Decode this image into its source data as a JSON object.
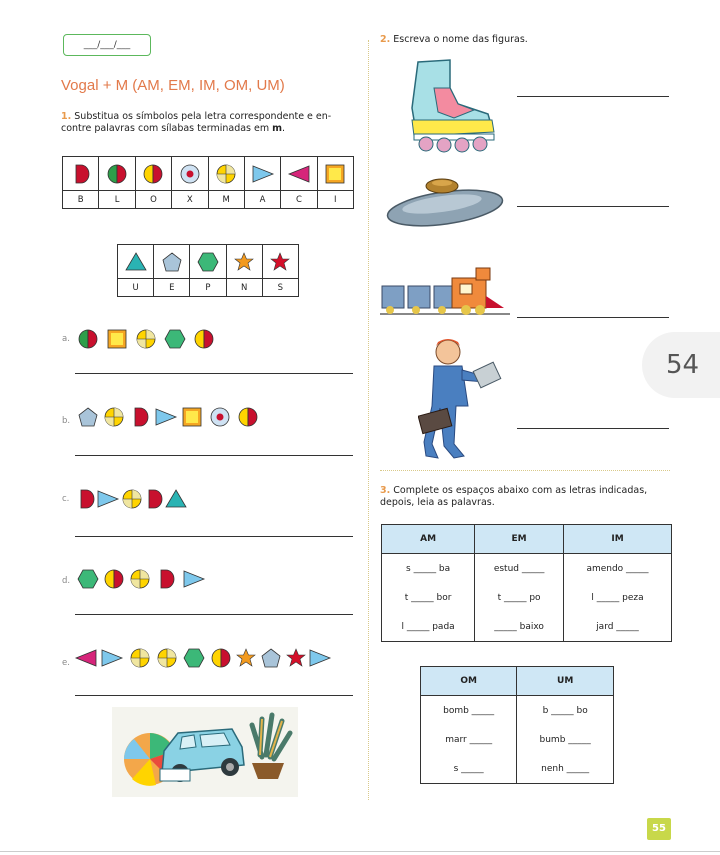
{
  "date_placeholder": "___/___/___",
  "left": {
    "title": "Vogal + M (AM, EM, IM, OM, UM)",
    "ex1": {
      "number": "1.",
      "text1": "Substitua os símbolos pela letra correspondente e en-",
      "text2": "contre palavras com sílabas terminadas em ",
      "text_bold": "m",
      "text_end": ".",
      "code1_letters": [
        "B",
        "L",
        "O",
        "X",
        "M",
        "A",
        "C",
        "I"
      ],
      "code2_letters": [
        "U",
        "E",
        "P",
        "N",
        "S"
      ],
      "items": [
        {
          "label": "a."
        },
        {
          "label": "b."
        },
        {
          "label": "c."
        },
        {
          "label": "d."
        },
        {
          "label": "e."
        }
      ]
    }
  },
  "right": {
    "ex2": {
      "number": "2.",
      "text": "Escreva o nome das figuras."
    },
    "ex3": {
      "number": "3.",
      "text1": "Complete os espaços abaixo com as letras indicadas,",
      "text2": "depois, leia as palavras.",
      "table1": {
        "headers": [
          "AM",
          "EM",
          "IM"
        ],
        "rows": [
          [
            "s _____ ba",
            "estud _____",
            "amendo _____"
          ],
          [
            "t _____ bor",
            "t _____ po",
            "l _____ peza"
          ],
          [
            "l _____ pada",
            "_____ baixo",
            "jard _____"
          ]
        ]
      },
      "table2": {
        "headers": [
          "OM",
          "UM"
        ],
        "rows": [
          [
            "bomb _____",
            "b _____ bo"
          ],
          [
            "marr _____",
            "bumb _____"
          ],
          [
            "s _____",
            "nenh _____"
          ]
        ]
      }
    }
  },
  "side_page_number": "54",
  "page_number": "55",
  "colors": {
    "accent_orange": "#e2794a",
    "table_header": "#cfe7f5",
    "badge": "#c8d84a"
  }
}
